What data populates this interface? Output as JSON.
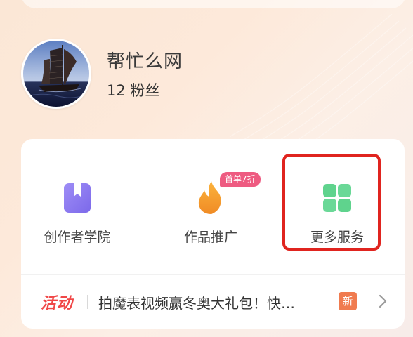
{
  "profile": {
    "name": "帮忙么网",
    "fans": "12 粉丝"
  },
  "services": [
    {
      "label": "创作者学院",
      "icon": "bookmark-book-icon",
      "color": "#8d7bf0"
    },
    {
      "label": "作品推广",
      "icon": "flame-icon",
      "color": "#f5a02c",
      "badge": "首单7折"
    },
    {
      "label": "更多服务",
      "icon": "grid-four-icon",
      "color": "#5fd38d"
    }
  ],
  "activity": {
    "tag": "活动",
    "text": "拍魔表视频赢冬奥大礼包！快…",
    "new_badge": "新",
    "tag_color": "#f04848",
    "new_color": "#f07b4f"
  },
  "highlight_color": "#e0241f"
}
